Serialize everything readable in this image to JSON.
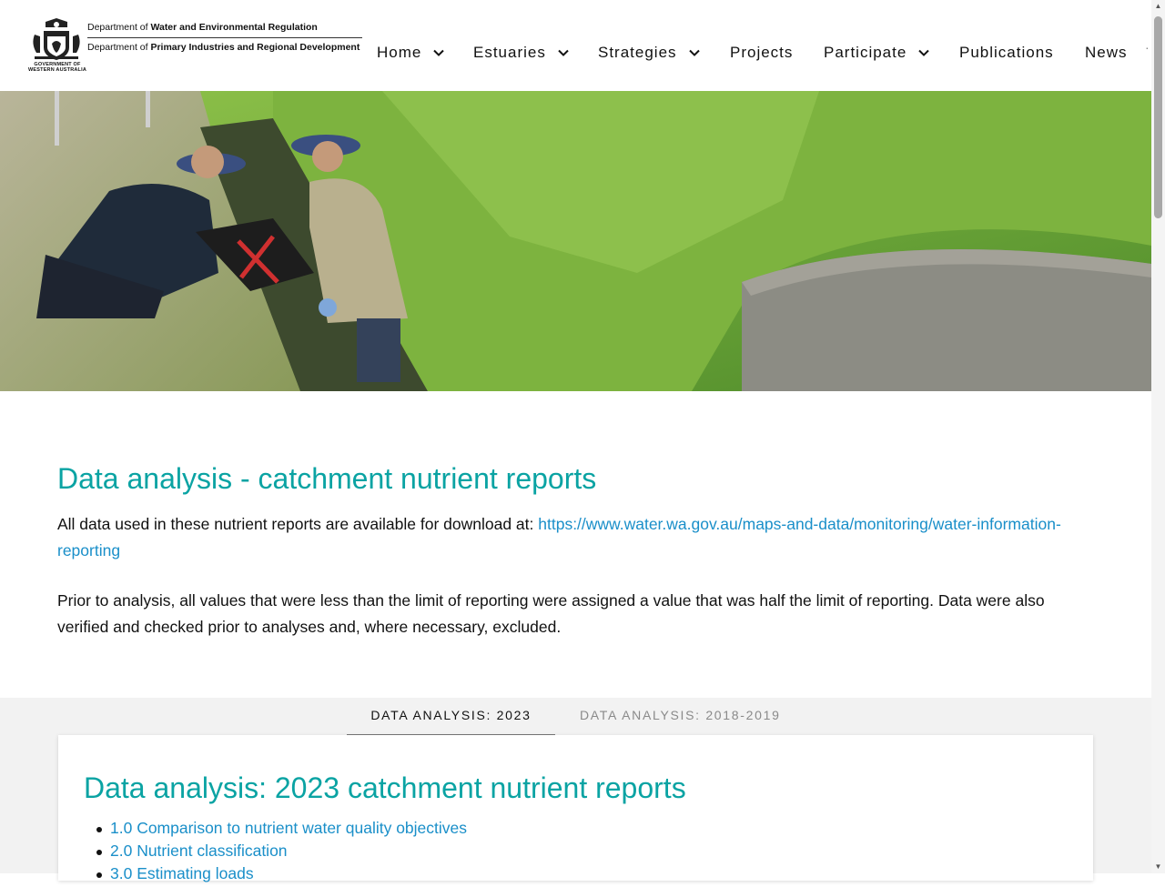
{
  "header": {
    "dept1_prefix": "Department of ",
    "dept1_name": "Water and Environmental Regulation",
    "dept2_prefix": "Department of ",
    "dept2_name": "Primary Industries and Regional Development",
    "govt_line1": "GOVERNMENT OF",
    "govt_line2": "WESTERN AUSTRALIA"
  },
  "nav": {
    "items": [
      {
        "label": "Home",
        "has_dropdown": true
      },
      {
        "label": "Estuaries",
        "has_dropdown": true
      },
      {
        "label": "Strategies",
        "has_dropdown": true
      },
      {
        "label": "Projects",
        "has_dropdown": false
      },
      {
        "label": "Participate",
        "has_dropdown": true
      },
      {
        "label": "Publications",
        "has_dropdown": false
      },
      {
        "label": "News",
        "has_dropdown": false
      }
    ]
  },
  "main": {
    "title": "Data analysis - catchment nutrient reports",
    "intro_text": "All data used in these nutrient reports are available for download at: ",
    "intro_link": "https://www.water.wa.gov.au/maps-and-data/monitoring/water-information-reporting",
    "para2": "Prior to analysis, all values that were less than the limit of reporting were assigned a value that was half the limit of reporting. Data were also verified and checked prior to analyses and, where necessary, excluded."
  },
  "tabs": [
    {
      "label": "DATA ANALYSIS: 2023",
      "active": true
    },
    {
      "label": "DATA ANALYSIS: 2018-2019",
      "active": false
    }
  ],
  "panel": {
    "title": "Data analysis: 2023 catchment nutrient reports",
    "toc": [
      "1.0 Comparison to nutrient water quality objectives",
      "2.0 Nutrient classification",
      "3.0 Estimating loads"
    ]
  },
  "colors": {
    "accent": "#0aa3a3",
    "link": "#1a8fc9"
  }
}
